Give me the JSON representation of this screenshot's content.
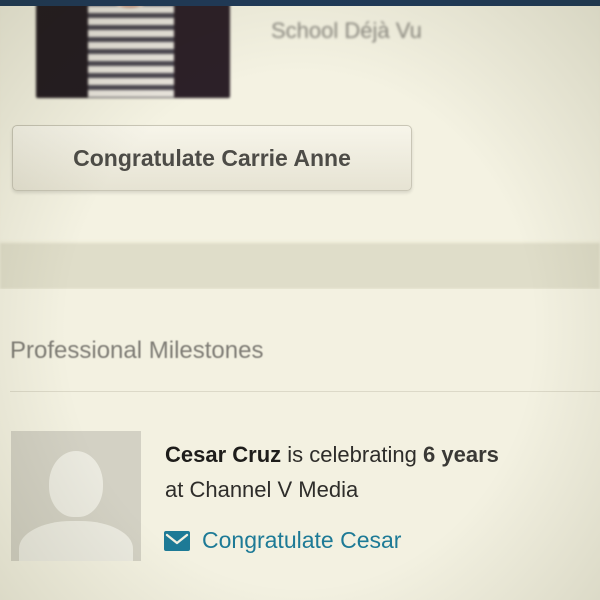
{
  "top_card": {
    "snippet_text": "School Déjà Vu",
    "congratulate_button_label": "Congratulate Carrie Anne"
  },
  "milestones": {
    "section_title": "Professional Milestones",
    "item": {
      "person_name": "Cesar Cruz",
      "text_middle": " is celebrating ",
      "duration": "6 years",
      "text_company": "at Channel V Media",
      "congratulate_link_label": "Congratulate Cesar"
    }
  },
  "colors": {
    "link": "#1d7a96",
    "top_edge": "#1f3a5a"
  },
  "icons": {
    "mail": "envelope-icon",
    "avatar": "default-avatar-silhouette"
  }
}
